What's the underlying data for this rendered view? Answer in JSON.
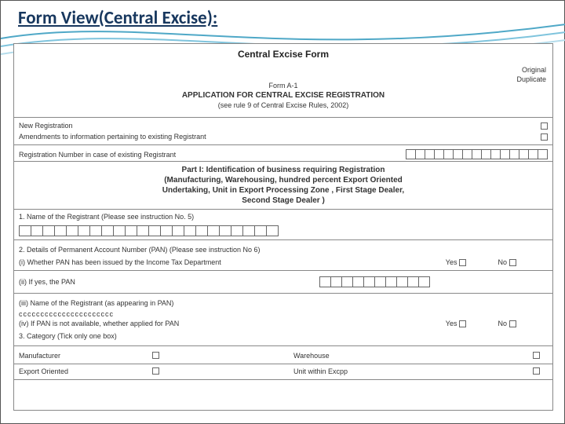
{
  "slide": {
    "title": "Form View(Central Excise):"
  },
  "form": {
    "title": "Central Excise Form",
    "top_right": {
      "original": "Original",
      "duplicate": "Duplicate"
    },
    "code": "Form A-1",
    "subtitle": "APPLICATION FOR CENTRAL EXCISE REGISTRATION",
    "rule": "(see rule 9 of Central Excise Rules, 2002)",
    "fields": {
      "new_reg": "New Registration",
      "amendments": "Amendments to information pertaining to existing Registrant",
      "reg_no": "Registration Number in case of existing Registrant"
    },
    "part1": {
      "line1": "Part I: Identification of business requiring Registration",
      "line2": "(Manufacturing, Warehousing, hundred percent Export Oriented",
      "line3": "Undertaking, Unit in Export Processing Zone , First Stage Dealer,",
      "line4": "Second Stage Dealer )"
    },
    "q1": "1. Name of the Registrant (Please see instruction No. 5)",
    "q2": "2. Details of Permanent Account Number (PAN) (Please see instruction No 6)",
    "q2i": "(i) Whether PAN has been issued by the Income Tax Department",
    "q2ii": "(ii) If yes, the PAN",
    "q2iii": "(iii) Name of the Registrant (as appearing in PAN)",
    "q2iii_filled": "cccccccccccccccccccccc",
    "q2iv": "(iv) If PAN is not available, whether applied for PAN",
    "q3": "3. Category (Tick only one box)",
    "yes": "Yes",
    "no": "No",
    "cat": {
      "manufacturer": "Manufacturer",
      "warehouse": "Warehouse",
      "export": "Export Oriented",
      "unit": "Unit within Excpp"
    }
  }
}
